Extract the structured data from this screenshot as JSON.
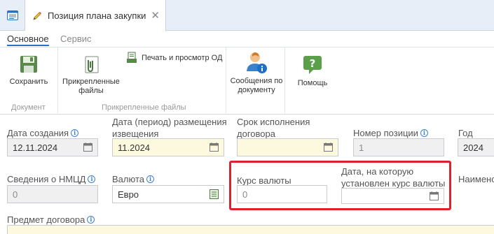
{
  "tab": {
    "title": "Позиция плана закупки",
    "close_glyph": "✕"
  },
  "ribbon_tabs": {
    "main": "Основное",
    "service": "Сервис"
  },
  "ribbon": {
    "save": "Сохранить",
    "attached_files": "Прикрепленные файлы",
    "print_preview": "Печать и просмотр ОД",
    "messages": "Сообщения по документу",
    "help": "Помощь",
    "group_document": "Документ",
    "group_attached": "Прикрепленные файлы"
  },
  "form": {
    "created_date": {
      "label": "Дата создания",
      "value": "12.11.2024"
    },
    "placement_date": {
      "label": "Дата (период) размещения извещения",
      "value": "11.2024"
    },
    "contract_term": {
      "label": "Срок исполнения договора",
      "value": ""
    },
    "position_number": {
      "label": "Номер позиции",
      "value": "1"
    },
    "plan_year": {
      "label": "Год план",
      "value": "2024"
    },
    "nmcd_info": {
      "label": "Сведения о НМЦД",
      "value": "0"
    },
    "currency": {
      "label": "Валюта",
      "value": "Евро"
    },
    "exchange_rate": {
      "label": "Курс валюты",
      "value": "0"
    },
    "rate_date": {
      "label": "Дата, на которую установлен курс валюты",
      "value": ""
    },
    "name_partial": {
      "label": "Наимено"
    },
    "contract_subject": {
      "label": "Предмет договора"
    }
  },
  "colors": {
    "accent": "#2a70c8",
    "highlight": "#e0202a",
    "required_bg": "#fdf9df",
    "readonly_bg": "#f0f0f0"
  }
}
